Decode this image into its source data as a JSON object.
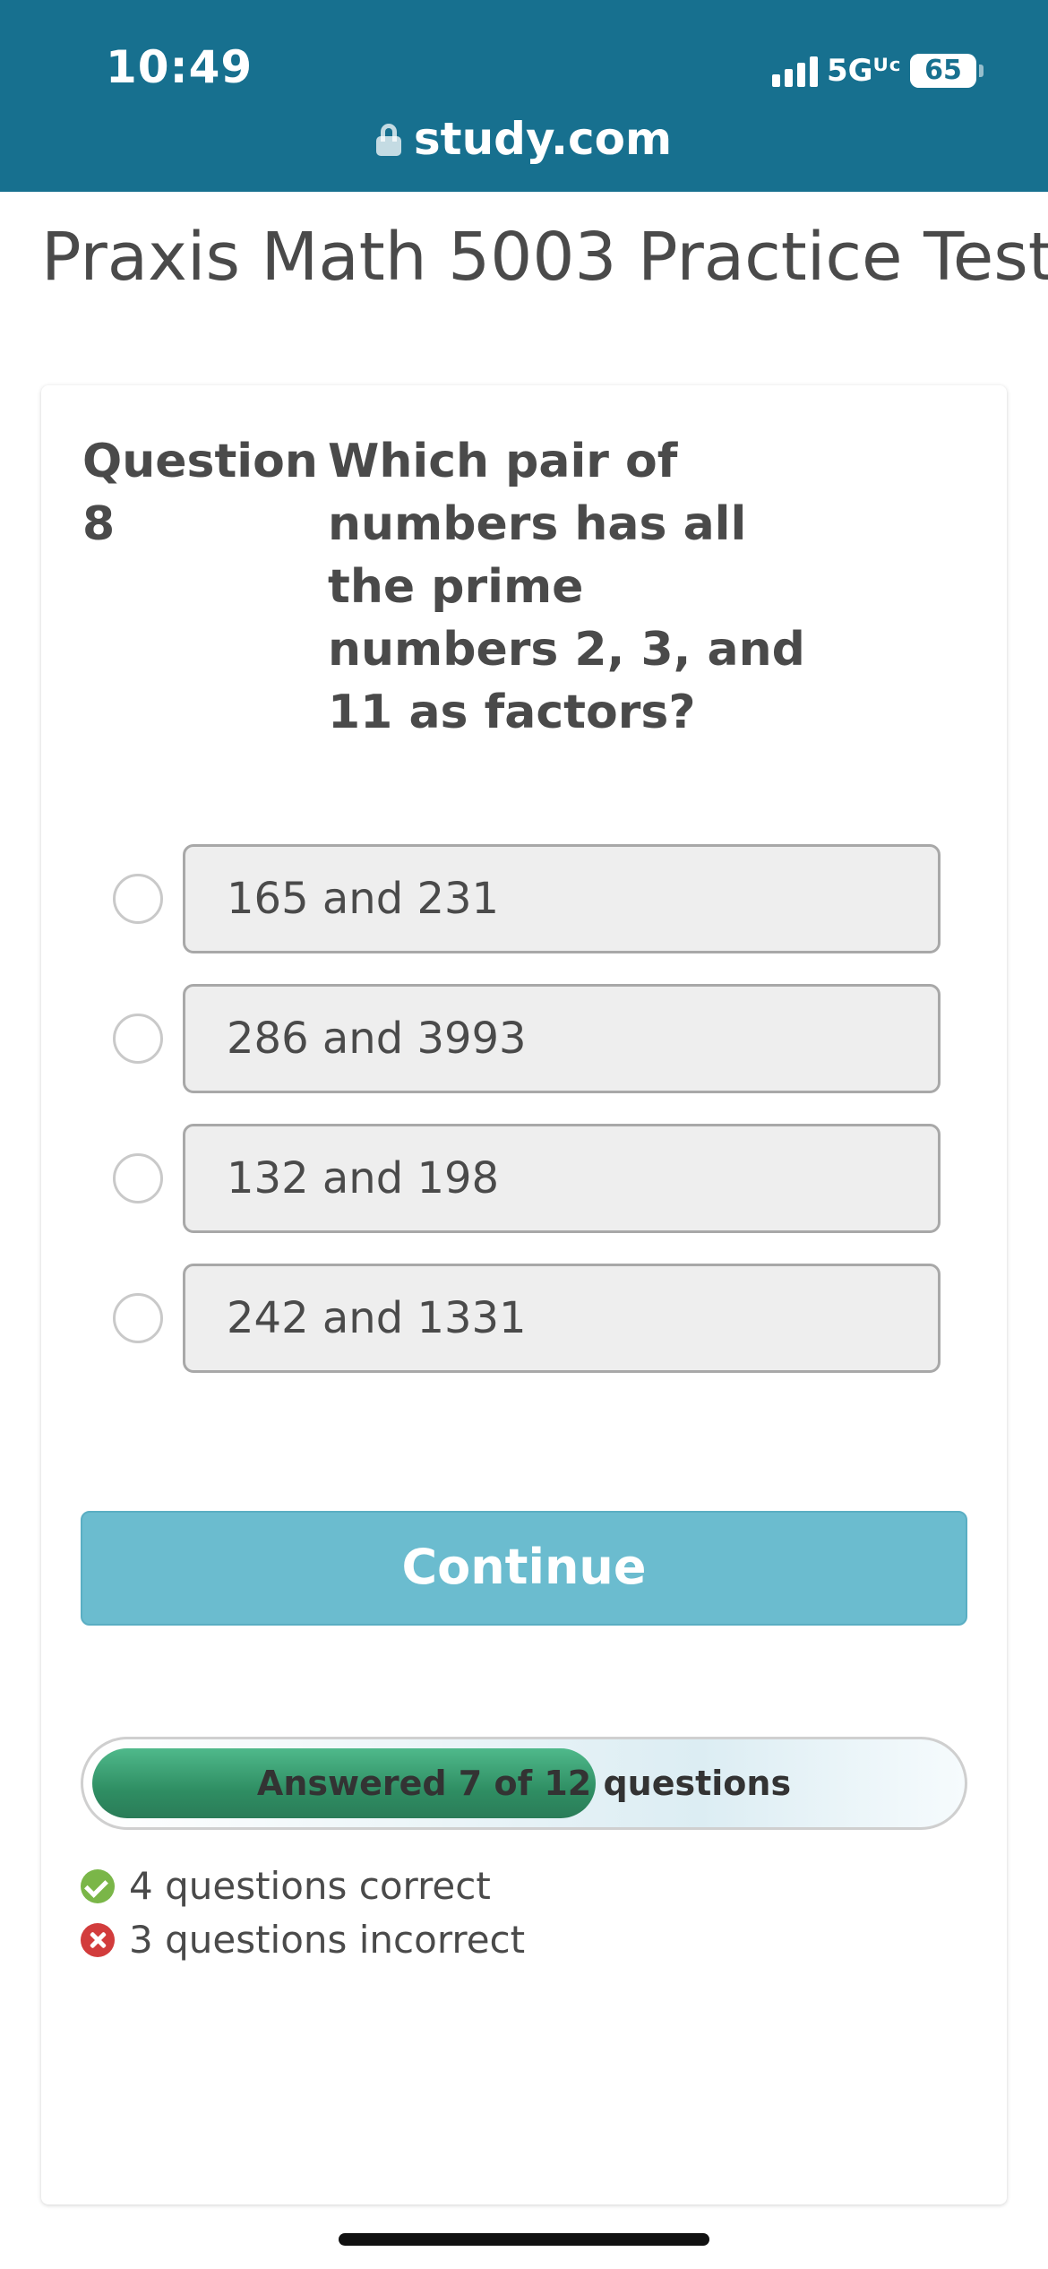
{
  "status_bar": {
    "time": "10:49",
    "network": "5Gᵁᶜ",
    "battery": "65"
  },
  "browser": {
    "url": "study.com"
  },
  "page": {
    "title": "Praxis Math 5003 Practice Test"
  },
  "question": {
    "label": "Question 8",
    "text": "Which pair of numbers has all the prime numbers 2, 3, and 11 as factors?",
    "options": [
      "165 and 231",
      "286 and 3993",
      "132 and 198",
      "242 and 1331"
    ]
  },
  "continue_label": "Continue",
  "progress": {
    "text": "Answered 7 of 12 questions",
    "answered": 7,
    "total": 12
  },
  "stats": {
    "correct": "4 questions correct",
    "incorrect": "3 questions incorrect"
  },
  "colors": {
    "header": "#17708f",
    "continue": "#6bbccf",
    "progress_fill": "#2f8e63",
    "correct": "#7ab648",
    "incorrect": "#d23c3c"
  }
}
